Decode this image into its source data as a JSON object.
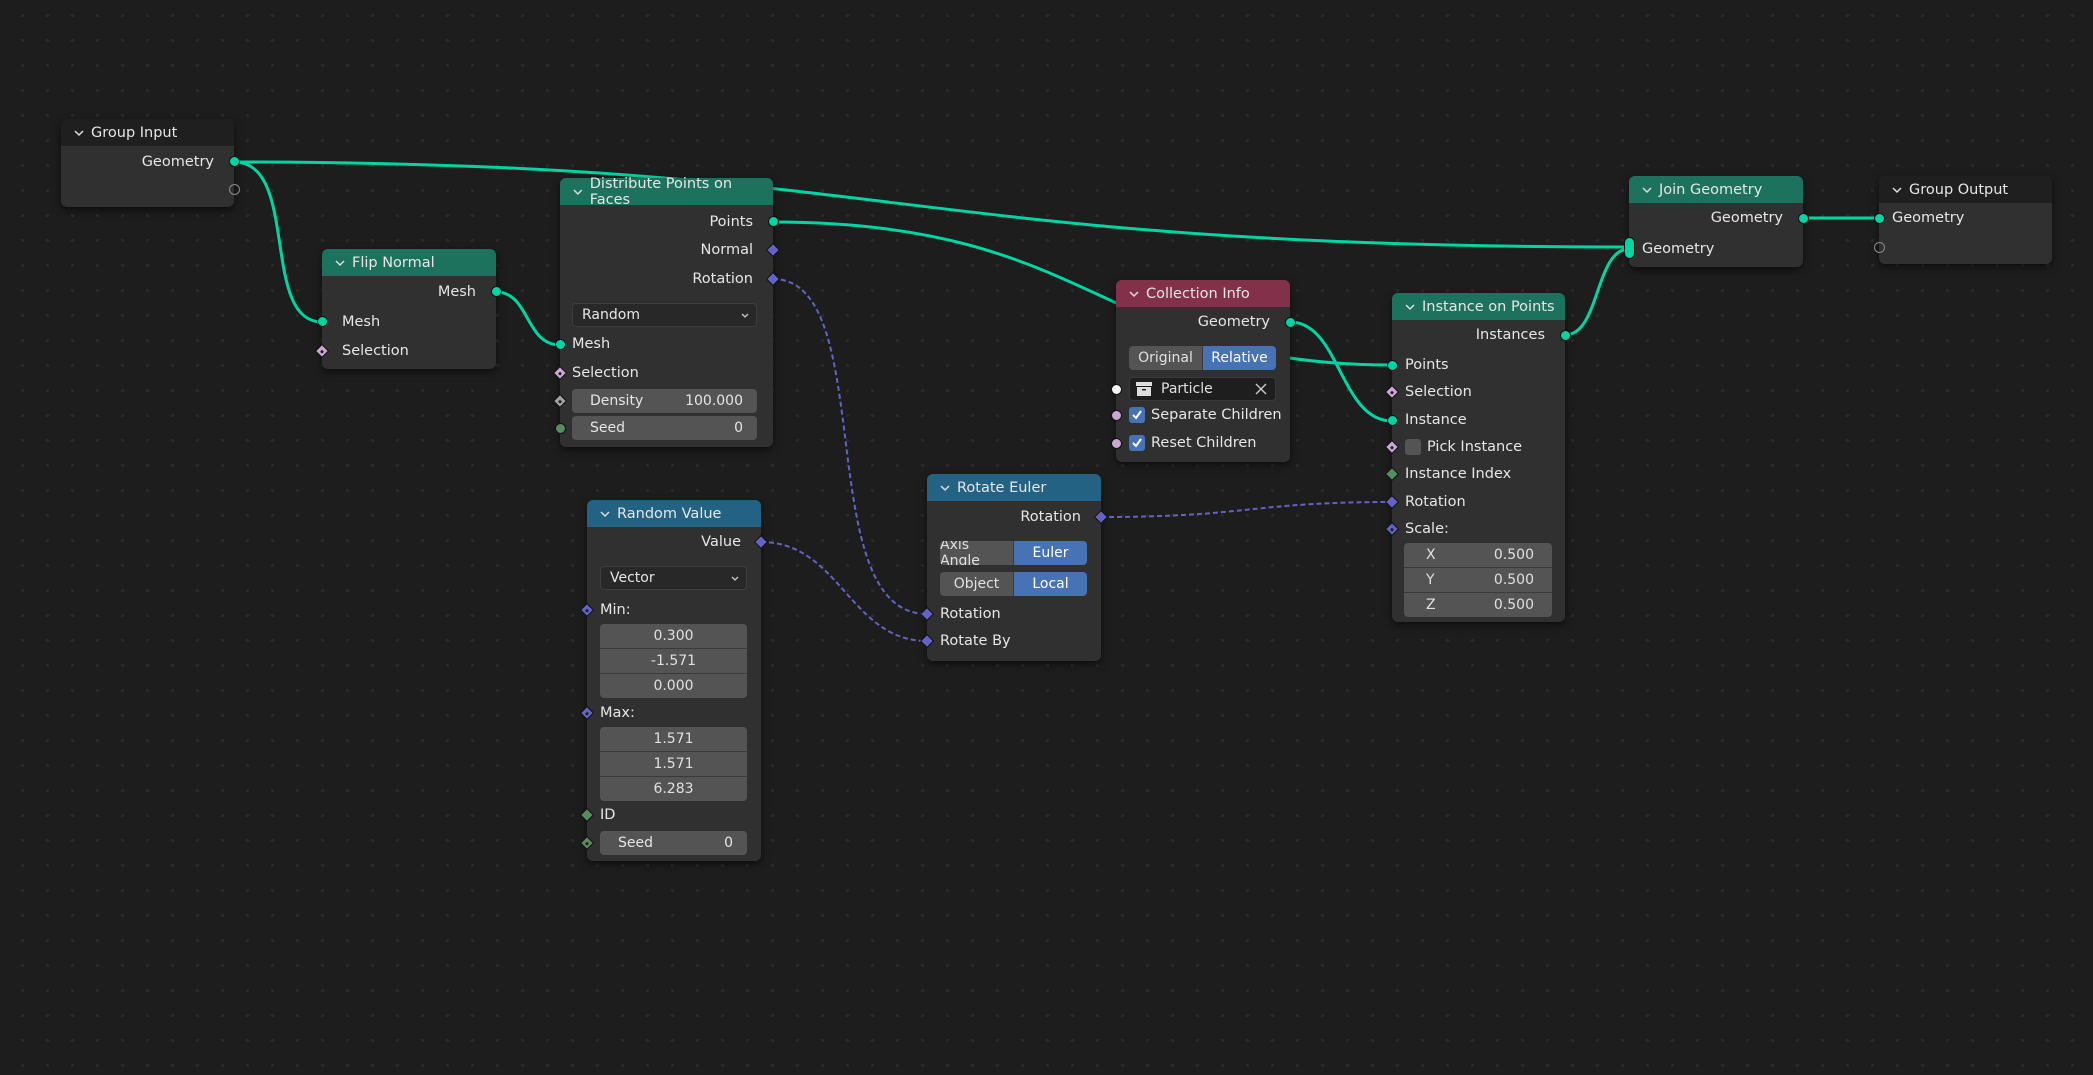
{
  "editor": "Geometry Node Editor",
  "colors": {
    "background": "#1d1d1d",
    "node_body": "#303030",
    "header_group": "#1f1f1f",
    "header_geometry": "#1d725e",
    "header_converter": "#246283",
    "header_input": "#83314a",
    "socket_geometry": "#00d6a3",
    "socket_vector": "#6363c7",
    "socket_boolean": "#cca6d6",
    "socket_float": "#a1a1a1",
    "socket_integer": "#598c5c",
    "socket_collection": "#f5f5f5",
    "accent": "#4772b3"
  },
  "nodes": {
    "group_input": {
      "title": "Group Input",
      "outputs": [
        "Geometry"
      ]
    },
    "flip_normal": {
      "title": "Flip Normal",
      "outputs": [
        "Mesh"
      ],
      "inputs": [
        "Mesh",
        "Selection"
      ]
    },
    "distribute": {
      "title": "Distribute Points on Faces",
      "outputs": [
        "Points",
        "Normal",
        "Rotation"
      ],
      "mode": "Random",
      "inputs": [
        "Mesh",
        "Selection"
      ],
      "density": {
        "label": "Density",
        "value": "100.000"
      },
      "seed": {
        "label": "Seed",
        "value": "0"
      }
    },
    "random_value": {
      "title": "Random Value",
      "outputs": [
        "Value"
      ],
      "type": "Vector",
      "min_label": "Min:",
      "min": [
        "0.300",
        "-1.571",
        "0.000"
      ],
      "max_label": "Max:",
      "max": [
        "1.571",
        "1.571",
        "6.283"
      ],
      "id_label": "ID",
      "seed": {
        "label": "Seed",
        "value": "0"
      }
    },
    "rotate_euler": {
      "title": "Rotate Euler",
      "outputs": [
        "Rotation"
      ],
      "type_options": [
        "Axis Angle",
        "Euler"
      ],
      "type_selected": "Euler",
      "space_options": [
        "Object",
        "Local"
      ],
      "space_selected": "Local",
      "inputs": [
        "Rotation",
        "Rotate By"
      ]
    },
    "collection_info": {
      "title": "Collection Info",
      "outputs": [
        "Geometry"
      ],
      "transform_options": [
        "Original",
        "Relative"
      ],
      "transform_selected": "Relative",
      "collection": "Particle",
      "separate_children": {
        "label": "Separate Children",
        "checked": true
      },
      "reset_children": {
        "label": "Reset Children",
        "checked": true
      }
    },
    "instance_on_points": {
      "title": "Instance on Points",
      "outputs": [
        "Instances"
      ],
      "inputs": [
        "Points",
        "Selection",
        "Instance"
      ],
      "pick_instance": {
        "label": "Pick Instance",
        "checked": false
      },
      "instance_index": "Instance Index",
      "rotation": "Rotation",
      "scale_label": "Scale:",
      "scale": [
        {
          "axis": "X",
          "value": "0.500"
        },
        {
          "axis": "Y",
          "value": "0.500"
        },
        {
          "axis": "Z",
          "value": "0.500"
        }
      ]
    },
    "join_geometry": {
      "title": "Join Geometry",
      "outputs": [
        "Geometry"
      ],
      "inputs": [
        "Geometry"
      ]
    },
    "group_output": {
      "title": "Group Output",
      "inputs": [
        "Geometry"
      ]
    }
  }
}
